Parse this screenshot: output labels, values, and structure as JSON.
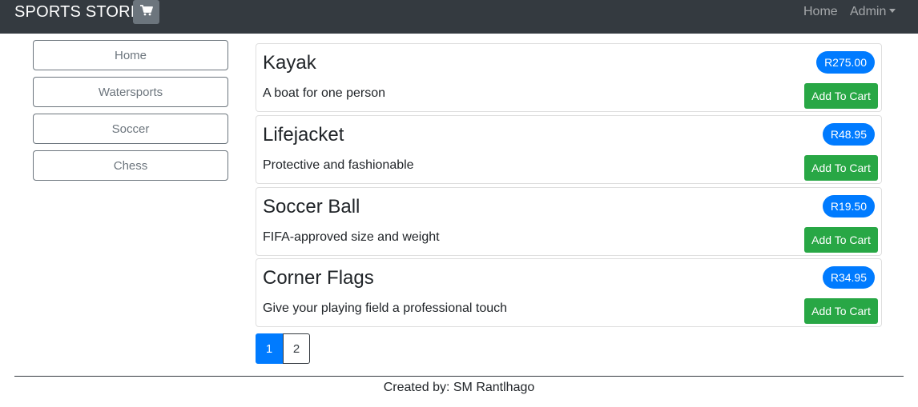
{
  "navbar": {
    "brand": "SPORTS STORE",
    "cart_icon": "shopping-cart-icon",
    "links": {
      "home": "Home",
      "admin": "Admin"
    }
  },
  "categories": [
    "Home",
    "Watersports",
    "Soccer",
    "Chess"
  ],
  "products": [
    {
      "name": "Kayak",
      "description": "A boat for one person",
      "price": "R275.00",
      "button": "Add To Cart"
    },
    {
      "name": "Lifejacket",
      "description": "Protective and fashionable",
      "price": "R48.95",
      "button": "Add To Cart"
    },
    {
      "name": "Soccer Ball",
      "description": "FIFA-approved size and weight",
      "price": "R19.50",
      "button": "Add To Cart"
    },
    {
      "name": "Corner Flags",
      "description": "Give your playing field a professional touch",
      "price": "R34.95",
      "button": "Add To Cart"
    }
  ],
  "pagination": {
    "pages": [
      "1",
      "2"
    ],
    "current": "1"
  },
  "footer": {
    "text": "Created by: SM Rantlhago"
  },
  "colors": {
    "navbar_bg": "#343a40",
    "primary": "#007bff",
    "success": "#28a745",
    "secondary": "#6c757d"
  }
}
